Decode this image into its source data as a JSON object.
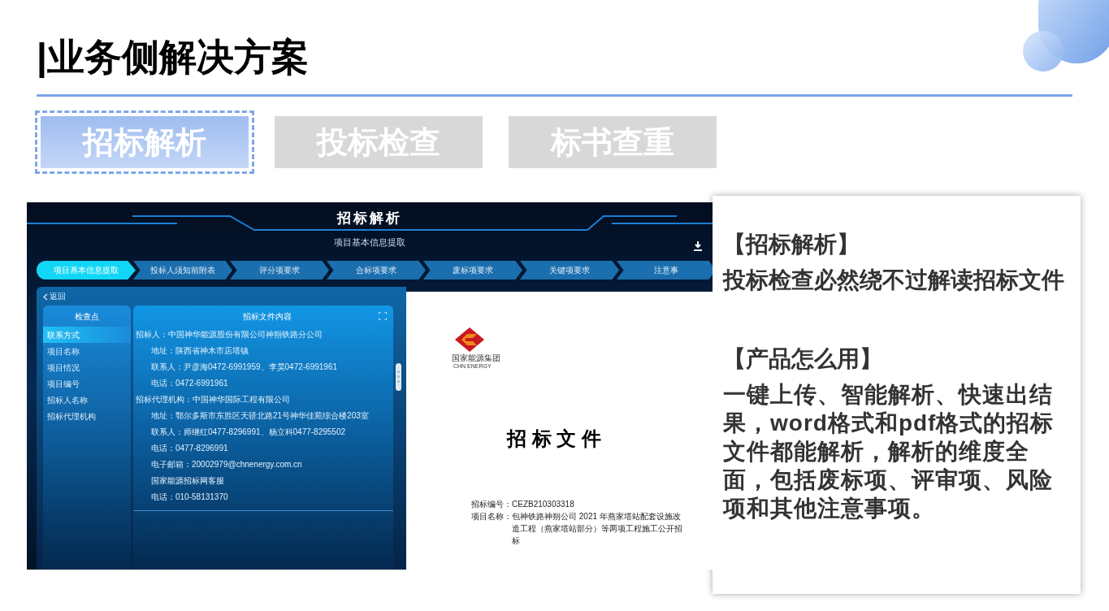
{
  "slide": {
    "title": "|业务侧解决方案"
  },
  "tabs": [
    {
      "label": "招标解析",
      "selected": true
    },
    {
      "label": "投标检查",
      "selected": false
    },
    {
      "label": "标书查重",
      "selected": false
    }
  ],
  "app": {
    "title": "招标解析",
    "subtitle": "项目基本信息提取",
    "steps": [
      {
        "label": "项目基本信息提取",
        "selected": true
      },
      {
        "label": "投标人须知前附表",
        "selected": false
      },
      {
        "label": "评分项要求",
        "selected": false
      },
      {
        "label": "合标项要求",
        "selected": false
      },
      {
        "label": "废标项要求",
        "selected": false
      },
      {
        "label": "关键项要求",
        "selected": false
      },
      {
        "label": "注意事",
        "selected": false
      }
    ],
    "back": "返回",
    "checkpoints": {
      "title": "检查点",
      "items": [
        {
          "label": "联系方式",
          "selected": true
        },
        {
          "label": "项目名称",
          "selected": false
        },
        {
          "label": "项目情况",
          "selected": false
        },
        {
          "label": "项目编号",
          "selected": false
        },
        {
          "label": "招标人名称",
          "selected": false
        },
        {
          "label": "招标代理机构",
          "selected": false
        }
      ]
    },
    "content": {
      "title": "招标文件内容",
      "lines": [
        {
          "kind": "main",
          "text": "招标人：中国神华能源股份有限公司神朔铁路分公司"
        },
        {
          "kind": "sub",
          "text": "地址：陕西省神木市店塔镇"
        },
        {
          "kind": "sub",
          "text": "联系人：尹彦海0472-6991959、李昊0472-6991961"
        },
        {
          "kind": "sub",
          "text": "电话：0472-6991961"
        },
        {
          "kind": "main",
          "text": "招标代理机构：中国神华国际工程有限公司"
        },
        {
          "kind": "sub",
          "text": "地址：鄂尔多斯市东胜区天骄北路21号神华佳苑综合楼203室"
        },
        {
          "kind": "sub",
          "text": "联系人：师继红0477-8296991、杨立科0477-8295502"
        },
        {
          "kind": "sub",
          "text": "电话：0477-8296991"
        },
        {
          "kind": "sub",
          "text": "电子邮箱：20002979@chnenergy.com.cn"
        },
        {
          "kind": "sub",
          "text": "国家能源招标网客服"
        },
        {
          "kind": "sub",
          "text": "电话：010-58131370"
        }
      ]
    },
    "document": {
      "logo_name": "国家能源集团",
      "logo_en": "CHN ENERGY",
      "title": "招 标 文 件",
      "fields": [
        {
          "label": "招标编号：",
          "value": "CEZB210303318"
        },
        {
          "label": "项目名称：",
          "value": "包神铁路神朔公司 2021 年燕家塔站配套设施改造工程（燕家塔站部分）等两项工程施工公开招标"
        }
      ]
    }
  },
  "card": {
    "heading_1": "【招标解析】",
    "text_1": "投标检查必然绕不过解读招标文件",
    "heading_2": "【产品怎么用】",
    "text_2": "一键上传、智能解析、快速出结果，word格式和pdf格式的招标文件都能解析，解析的维度全面，包括废标项、评审项、风险项和其他注意事项。"
  }
}
